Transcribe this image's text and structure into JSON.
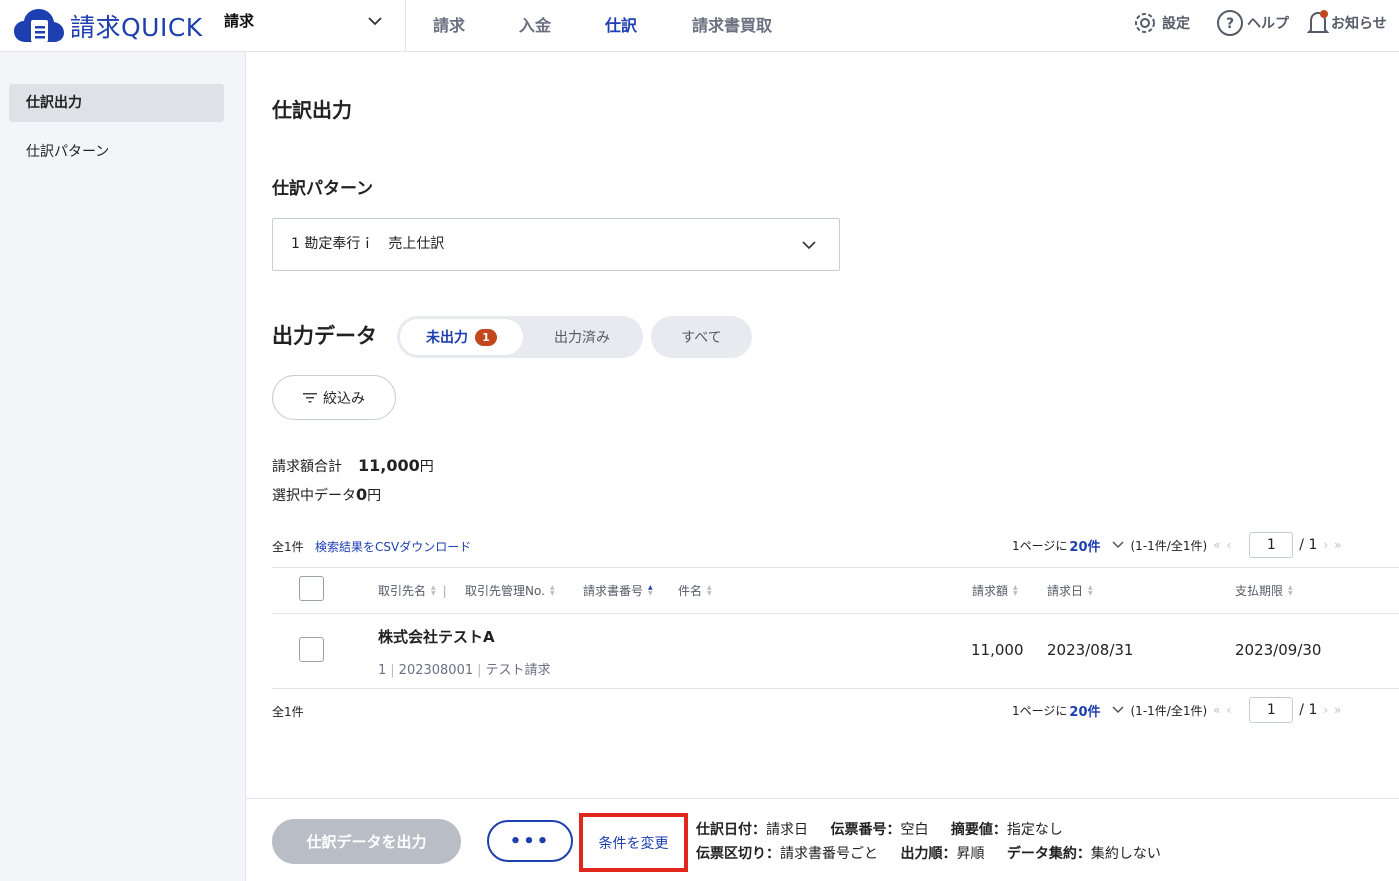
{
  "header": {
    "logo_text": "請求QUICK",
    "app_select": "請求",
    "nav": [
      "請求",
      "入金",
      "仕訳",
      "請求書買取"
    ],
    "settings_label": "設定",
    "help_label": "ヘルプ",
    "notice_label": "お知らせ",
    "brand_color": "#1e3fb0"
  },
  "sidebar": {
    "items": [
      {
        "label": "仕訳出力",
        "active": true
      },
      {
        "label": "仕訳パターン",
        "active": false
      }
    ]
  },
  "main": {
    "page_title": "仕訳出力",
    "pattern_heading": "仕訳パターン",
    "pattern_value": "1 勘定奉行ｉ　売上仕訳",
    "output_heading": "出力データ",
    "tabs": {
      "unexported": "未出力",
      "unexported_badge": "1",
      "exported": "出力済み",
      "all": "すべて"
    },
    "filter_label": "絞込み",
    "total_label": "請求額合計",
    "total_value": "11,000",
    "total_unit": "円",
    "selected_label": "選択中データ",
    "selected_value": "0",
    "selected_unit": "円",
    "count_text": "全1件",
    "csv_link": "検索結果をCSVダウンロード",
    "pager": {
      "per_page_prefix": "1ページに",
      "per_page_value": "20件",
      "range": "(1-1件/全1件)",
      "page": "1",
      "total_pages": "/ 1"
    },
    "columns": {
      "client": "取引先名",
      "client_no": "取引先管理No.",
      "invoice_no": "請求書番号",
      "subject": "件名",
      "amount": "請求額",
      "invoice_date": "請求日",
      "due_date": "支払期限"
    },
    "rows": [
      {
        "client": "株式会社テストA",
        "client_no": "1",
        "invoice_no": "202308001",
        "subject": "テスト請求",
        "amount": "11,000",
        "invoice_date": "2023/08/31",
        "due_date": "2023/09/30"
      }
    ]
  },
  "footer": {
    "export_button": "仕訳データを出力",
    "more_button": "•••",
    "change_button": "条件を変更",
    "conditions": {
      "date_label": "仕訳日付：",
      "date_value": "請求日",
      "slip_no_label": "伝票番号：",
      "slip_no_value": "空白",
      "summary_label": "摘要値：",
      "summary_value": "指定なし",
      "slip_split_label": "伝票区切り：",
      "slip_split_value": "請求書番号ごと",
      "order_label": "出力順：",
      "order_value": "昇順",
      "aggregate_label": "データ集約：",
      "aggregate_value": "集約しない"
    },
    "highlight_color": "#e1261c"
  }
}
